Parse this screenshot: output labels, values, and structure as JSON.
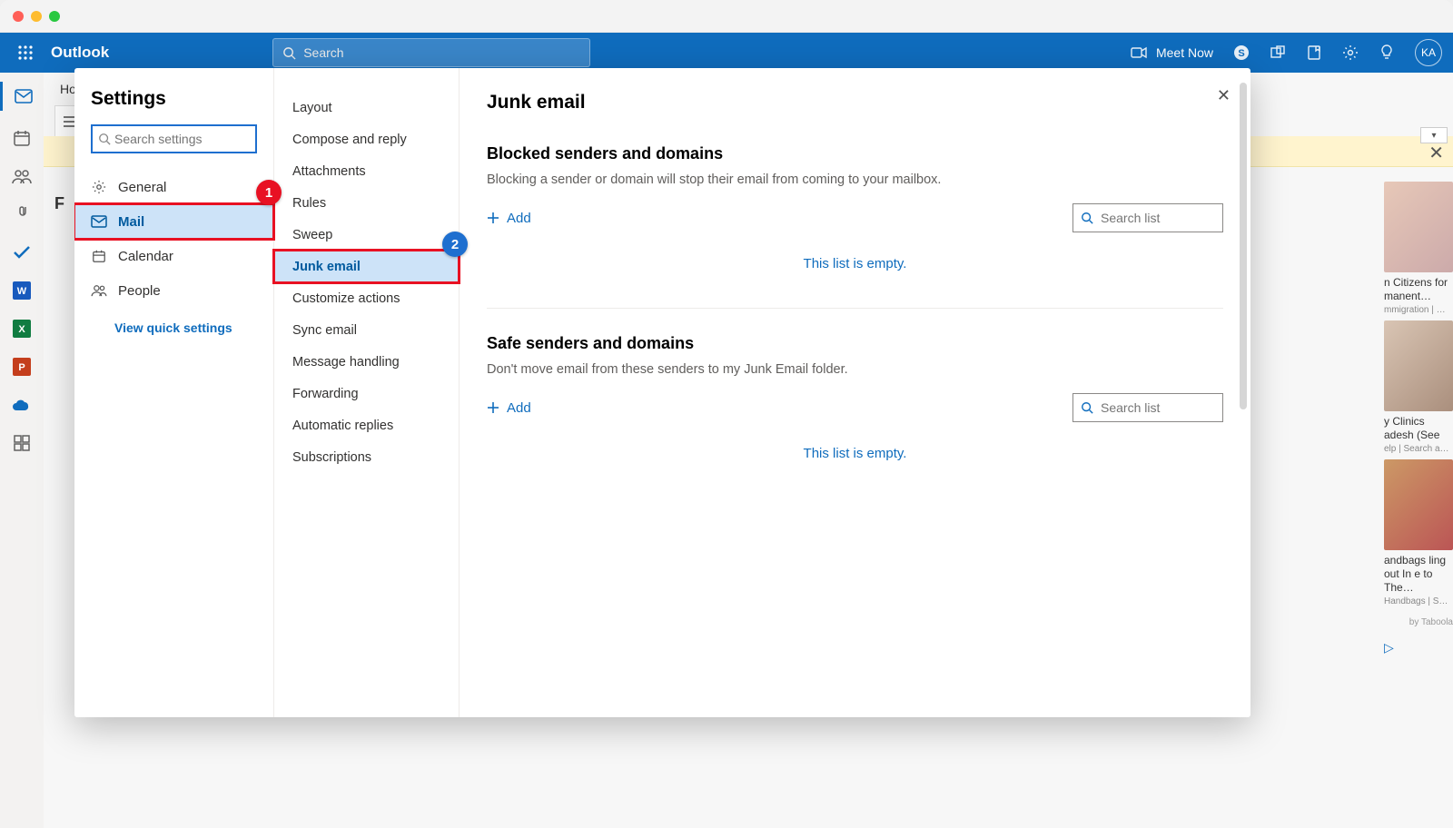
{
  "header": {
    "app_name": "Outlook",
    "search_placeholder": "Search",
    "meet_now": "Meet Now",
    "avatar": "KA"
  },
  "ribbon": {
    "tab1": "Ho"
  },
  "settings": {
    "title": "Settings",
    "search_placeholder": "Search settings",
    "categories": [
      {
        "icon": "gear",
        "label": "General"
      },
      {
        "icon": "mail",
        "label": "Mail"
      },
      {
        "icon": "calendar",
        "label": "Calendar"
      },
      {
        "icon": "people",
        "label": "People"
      }
    ],
    "quick_link": "View quick settings"
  },
  "sub_items": [
    "Layout",
    "Compose and reply",
    "Attachments",
    "Rules",
    "Sweep",
    "Junk email",
    "Customize actions",
    "Sync email",
    "Message handling",
    "Forwarding",
    "Automatic replies",
    "Subscriptions"
  ],
  "junk": {
    "title": "Junk email",
    "blocked_head": "Blocked senders and domains",
    "blocked_desc": "Blocking a sender or domain will stop their email from coming to your mailbox.",
    "safe_head": "Safe senders and domains",
    "safe_desc": "Don't move email from these senders to my Junk Email folder.",
    "add": "Add",
    "search_list": "Search list",
    "empty": "This list is empty."
  },
  "ads": [
    {
      "title": "n Citizens  for  manent…",
      "meta": "mmigration | …"
    },
    {
      "title": "y Clinics adesh (See",
      "meta": "elp | Search a…"
    },
    {
      "title": "andbags ling out In e to The…",
      "meta": "Handbags | S…"
    }
  ],
  "taboola": "by Taboola",
  "callouts": {
    "one": "1",
    "two": "2"
  },
  "folder_initial": "F"
}
